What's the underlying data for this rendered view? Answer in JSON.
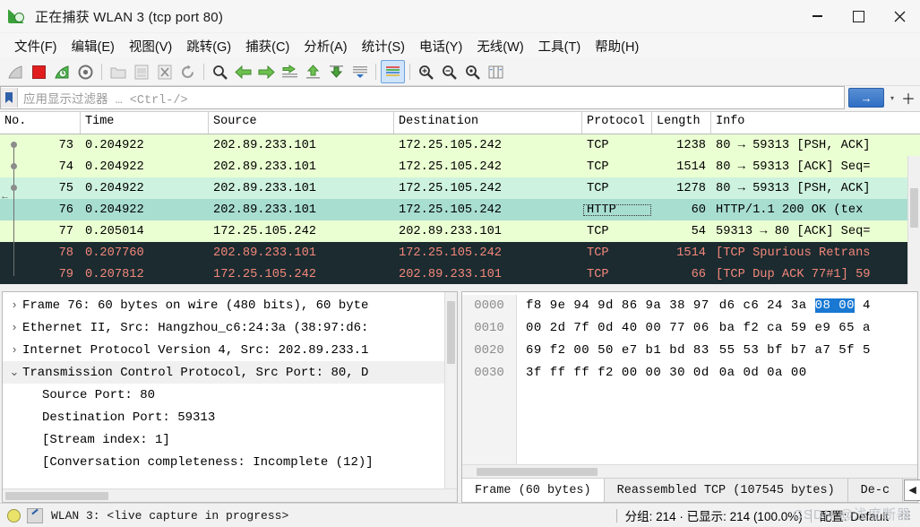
{
  "window": {
    "title": "正在捕获 WLAN 3 (tcp port 80)",
    "app_icon": "wireshark-fin-icon",
    "minimize": "—",
    "maximize": "□",
    "close": "✕"
  },
  "menu": {
    "items": [
      {
        "label": "文件(F)",
        "name": "menu-file"
      },
      {
        "label": "编辑(E)",
        "name": "menu-edit"
      },
      {
        "label": "视图(V)",
        "name": "menu-view"
      },
      {
        "label": "跳转(G)",
        "name": "menu-go"
      },
      {
        "label": "捕获(C)",
        "name": "menu-capture"
      },
      {
        "label": "分析(A)",
        "name": "menu-analyze"
      },
      {
        "label": "统计(S)",
        "name": "menu-statistics"
      },
      {
        "label": "电话(Y)",
        "name": "menu-telephony"
      },
      {
        "label": "无线(W)",
        "name": "menu-wireless"
      },
      {
        "label": "工具(T)",
        "name": "menu-tools"
      },
      {
        "label": "帮助(H)",
        "name": "menu-help"
      }
    ]
  },
  "toolbar": {
    "icons": [
      "start-capture-icon",
      "stop-capture-icon",
      "restart-capture-icon",
      "capture-options-icon",
      "open-file-icon",
      "save-file-icon",
      "close-file-icon",
      "reload-file-icon",
      "find-packet-icon",
      "go-back-icon",
      "go-forward-icon",
      "go-to-packet-icon",
      "go-first-packet-icon",
      "go-last-packet-icon",
      "auto-scroll-icon",
      "colorize-icon",
      "zoom-in-icon",
      "zoom-out-icon",
      "zoom-reset-icon",
      "resize-columns-icon"
    ]
  },
  "filter": {
    "placeholder": "应用显示过滤器 … <Ctrl-/>",
    "value": "",
    "bookmark_icon": "bookmark-icon",
    "apply_icon": "→",
    "dropdown_icon": "▾",
    "add_icon": "＋"
  },
  "packet_list": {
    "columns": [
      {
        "key": "no",
        "label": "No."
      },
      {
        "key": "time",
        "label": "Time"
      },
      {
        "key": "source",
        "label": "Source"
      },
      {
        "key": "destination",
        "label": "Destination"
      },
      {
        "key": "protocol",
        "label": "Protocol"
      },
      {
        "key": "length",
        "label": "Length"
      },
      {
        "key": "info",
        "label": "Info"
      }
    ],
    "rows": [
      {
        "no": "73",
        "time": "0.204922",
        "source": "202.89.233.101",
        "destination": "172.25.105.242",
        "protocol": "TCP",
        "length": "1238",
        "info": "80 → 59313 [PSH, ACK]",
        "style": "bg-l"
      },
      {
        "no": "74",
        "time": "0.204922",
        "source": "202.89.233.101",
        "destination": "172.25.105.242",
        "protocol": "TCP",
        "length": "1514",
        "info": "80 → 59313 [ACK] Seq=",
        "style": "bg-l"
      },
      {
        "no": "75",
        "time": "0.204922",
        "source": "202.89.233.101",
        "destination": "172.25.105.242",
        "protocol": "TCP",
        "length": "1278",
        "info": "80 → 59313 [PSH, ACK]",
        "style": "bg-m"
      },
      {
        "no": "76",
        "time": "0.204922",
        "source": "202.89.233.101",
        "destination": "172.25.105.242",
        "protocol": "HTTP",
        "length": "60",
        "info": "HTTP/1.1 200 OK  (tex",
        "style": "bg-sel"
      },
      {
        "no": "77",
        "time": "0.205014",
        "source": "172.25.105.242",
        "destination": "202.89.233.101",
        "protocol": "TCP",
        "length": "54",
        "info": "59313 → 80 [ACK] Seq=",
        "style": "bg-l"
      },
      {
        "no": "78",
        "time": "0.207760",
        "source": "202.89.233.101",
        "destination": "172.25.105.242",
        "protocol": "TCP",
        "length": "1514",
        "info": "[TCP Spurious Retrans",
        "style": "bg-dark"
      },
      {
        "no": "79",
        "time": "0.207812",
        "source": "172.25.105.242",
        "destination": "202.89.233.101",
        "protocol": "TCP",
        "length": "66",
        "info": "[TCP Dup ACK 77#1] 59",
        "style": "bg-dark"
      }
    ]
  },
  "details": {
    "rows": [
      {
        "chevron": "›",
        "text": "Frame 76: 60 bytes on wire (480 bits), 60 byte",
        "level": "l1",
        "name": "detail-frame"
      },
      {
        "chevron": "›",
        "text": "Ethernet II, Src: Hangzhou_c6:24:3a (38:97:d6:",
        "level": "l1",
        "name": "detail-ethernet"
      },
      {
        "chevron": "›",
        "text": "Internet Protocol Version 4, Src: 202.89.233.1",
        "level": "l1",
        "name": "detail-ipv4"
      },
      {
        "chevron": "⌄",
        "text": "Transmission Control Protocol, Src Port: 80, D",
        "level": "l1",
        "name": "detail-tcp"
      },
      {
        "chevron": "",
        "text": "Source Port: 80",
        "level": "l2",
        "name": "detail-source-port"
      },
      {
        "chevron": "",
        "text": "Destination Port: 59313",
        "level": "l2",
        "name": "detail-destination-port"
      },
      {
        "chevron": "",
        "text": "[Stream index: 1]",
        "level": "l2",
        "name": "detail-stream-index"
      },
      {
        "chevron": "",
        "text": "[Conversation completeness: Incomplete (12)]",
        "level": "l2",
        "name": "detail-conversation-completeness"
      }
    ]
  },
  "bytes": {
    "rows": [
      {
        "offset": "0000",
        "pre": "f8 9e 94 9d 86 9a 38 97",
        "mid": "d6 c6 24 3a ",
        "sel": "08 00",
        "post": " 4"
      },
      {
        "offset": "0010",
        "pre": "00 2d 7f 0d 40 00 77 06",
        "mid": "ba f2 ca 59 e9 65 a",
        "sel": "",
        "post": ""
      },
      {
        "offset": "0020",
        "pre": "69 f2 00 50 e7 b1 bd 83",
        "mid": "55 53 bf b7 a7 5f 5",
        "sel": "",
        "post": ""
      },
      {
        "offset": "0030",
        "pre": "3f ff ff f2 00 00 30 0d",
        "mid": "0a 0d 0a 00",
        "sel": "",
        "post": ""
      }
    ]
  },
  "tabs": {
    "items": [
      {
        "label": "Frame (60 bytes)",
        "active": true,
        "name": "tab-frame"
      },
      {
        "label": "Reassembled TCP (107545 bytes)",
        "active": false,
        "name": "tab-reassembled-tcp"
      },
      {
        "label": "De-c",
        "active": false,
        "name": "tab-decompressed"
      }
    ],
    "prev_icon": "◀",
    "next_icon": "▶"
  },
  "status": {
    "capture_icon": "capture-active-icon",
    "expert_icon": "capture-comment-icon",
    "interface_text": "WLAN 3: <live capture in progress>",
    "packets_text": "分组: 214 · 已显示: 214 (100.0%)",
    "profile_text": "配置: Default"
  },
  "watermark": "CSDN @浅度断器"
}
